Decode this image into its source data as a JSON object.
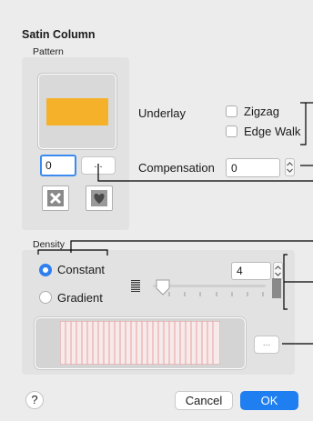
{
  "dialog": {
    "title": "Satin Column"
  },
  "pattern": {
    "group_label": "Pattern",
    "swatch_color": "#f4b129",
    "number_value": "0",
    "browse_label": "..."
  },
  "underlay": {
    "label": "Underlay",
    "options": [
      {
        "label": "Zigzag",
        "checked": false
      },
      {
        "label": "Edge Walk",
        "checked": false
      }
    ]
  },
  "compensation": {
    "label": "Compensation",
    "value": "0"
  },
  "density": {
    "group_label": "Density",
    "options": [
      {
        "label": "Constant",
        "selected": true
      },
      {
        "label": "Gradient",
        "selected": false
      }
    ],
    "value": "4",
    "slider_level": 0,
    "browse_label": "..."
  },
  "footer": {
    "help_label": "?",
    "cancel_label": "Cancel",
    "ok_label": "OK"
  },
  "colors": {
    "accent": "#1f7ef0",
    "swatch": "#f4b129",
    "preview_stitch": "#e8a0a0"
  },
  "icons": [
    "help-icon",
    "remove-pattern-icon",
    "favorite-heart-icon",
    "stepper-icon",
    "density-low-icon",
    "density-high-icon"
  ]
}
